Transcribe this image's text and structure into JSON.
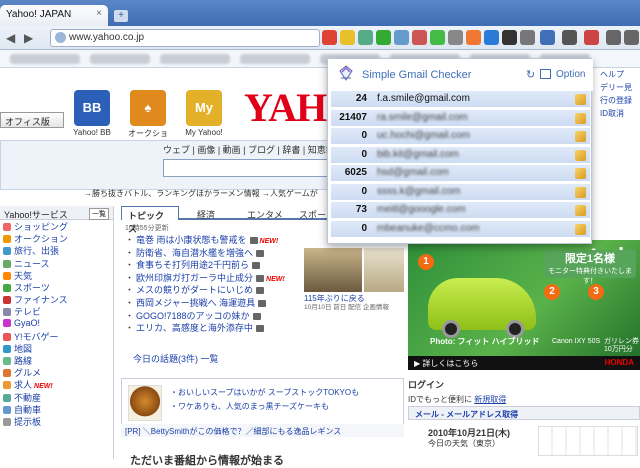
{
  "browser": {
    "tab_title": "Yahoo! JAPAN",
    "tab_close": "×",
    "new_tab": "+",
    "address": "www.yahoo.co.jp",
    "nav_back": "◀",
    "nav_forward": "▶"
  },
  "page": {
    "logo_text": "YAHO",
    "office_button": "オフィス版",
    "services": [
      {
        "label": "Yahoo! BB",
        "glyph": "BB",
        "color": "#2b5fb8"
      },
      {
        "label": "オークション",
        "glyph": "♠",
        "color": "#e08a1e"
      },
      {
        "label": "My Yahoo!",
        "glyph": "My",
        "color": "#e3b02a"
      }
    ],
    "search_tabs": "ウェブ | 画像 | 動画 | ブログ | 辞書 | 知恵袋",
    "promo_left": "→勝ち抜きバトル、ランキングほかラーメン情報",
    "promo_right": "→人気ゲームが",
    "sidebar": {
      "header": "Yahoo!サービス",
      "header_tag": "一覧",
      "items": [
        {
          "label": "ショッピング",
          "color": "#e66"
        },
        {
          "label": "オークション",
          "color": "#e90"
        },
        {
          "label": "旅行、出張",
          "color": "#49c"
        },
        {
          "label": "ニュース",
          "color": "#6a6"
        },
        {
          "label": "天気",
          "color": "#f80"
        },
        {
          "label": "スポーツ",
          "color": "#4a4"
        },
        {
          "label": "ファイナンス",
          "color": "#c33"
        },
        {
          "label": "テレビ",
          "color": "#88a"
        },
        {
          "label": "GyaO!",
          "color": "#c3c"
        },
        {
          "label": "Y!モバゲー",
          "color": "#e55"
        },
        {
          "label": "地図",
          "color": "#39c"
        },
        {
          "label": "路線",
          "color": "#6b8"
        },
        {
          "label": "グルメ",
          "color": "#d73"
        },
        {
          "label": "求人",
          "color": "#e93",
          "new": "NEW!"
        },
        {
          "label": "不動産",
          "color": "#5a9"
        },
        {
          "label": "自動車",
          "color": "#69c"
        },
        {
          "label": "提示板",
          "color": "#999"
        }
      ]
    },
    "topics": {
      "tabs": [
        "トピックス",
        "経済",
        "エンタメ",
        "スポー"
      ],
      "time": "10時55分更新",
      "items": [
        {
          "text": "竜巻 雨は小康状態も警戒を",
          "new": "NEW!"
        },
        {
          "text": "防衛省、海自潜水艦を増強へ",
          "new": ""
        },
        {
          "text": "食事ちそ打列用途2千円前ら",
          "new": ""
        },
        {
          "text": "欧州印旗ガ打ガーラ中止成分",
          "new": "NEW!"
        },
        {
          "text": "メスの競りがダートにいじめ",
          "new": ""
        },
        {
          "text": "西岡メジャー挑戦へ 海運遊具",
          "new": ""
        },
        {
          "text": "GOGO!7188のアッコの妹か",
          "new": ""
        },
        {
          "text": "エリカ、高感度と海外添存中",
          "new": ""
        }
      ],
      "photo_caption": "115年ぶりに戻る",
      "photo_sub": "10月10日 前日 配信 企画情報",
      "footer": "今日の話題(3件)  一覧"
    },
    "soup": {
      "line1": "・おいしいスープはいかが スープストックTOKYOも",
      "line2": "・ワケありも、人気のまっ黒チーズケーキも"
    },
    "pr": "[PR] ＼BettySmithがこの価格で？／細部にもる逸品レギンス",
    "bottom_heading": "ただいま番組から情報が始まる",
    "ad": {
      "top_text": "ント",
      "limited_big": "限定1名様",
      "limited_small": "モニター特典付きいたします！",
      "num1": "1",
      "num2": "2",
      "num3": "3",
      "car_caption": "Photo: フィット ハイブリッド",
      "cam_label": "Canon IXY 50S",
      "gps_label": "ガリレン券 10万円分",
      "bottom": "▶ 詳しくはこちら",
      "brand": "HONDA"
    },
    "login": {
      "title": "ログイン",
      "line": "IDでもっと便利に",
      "link": "新規取得",
      "mail_bar": "メール - メールアドレス取得",
      "date": "2010年10月21日(木)",
      "weather": "今日の天気（東京）"
    },
    "right_links": [
      "ヘルプ",
      "デリー見",
      "行の登録",
      "ID取消"
    ]
  },
  "gmail_checker": {
    "title": "Simple Gmail Checker",
    "refresh_icon": "↻",
    "option_label": "Option",
    "accounts": [
      {
        "count": "24",
        "email": "f.a.smile@gmail.com",
        "blurred": false
      },
      {
        "count": "21407",
        "email": "ra.smile@gmail.com",
        "blurred": true
      },
      {
        "count": "0",
        "email": "uc.hochi@gmail.com",
        "blurred": true
      },
      {
        "count": "0",
        "email": "bib.kit@gmail.com",
        "blurred": true
      },
      {
        "count": "6025",
        "email": "hsd@gmail.com",
        "blurred": true
      },
      {
        "count": "0",
        "email": "ssss.k@gmail.com",
        "blurred": true
      },
      {
        "count": "73",
        "email": "meitl@gooogle.com",
        "blurred": true
      },
      {
        "count": "0",
        "email": "mbeanuke@ccmo.com",
        "blurred": true
      }
    ]
  },
  "colors": {
    "accent": "#3e6fb7",
    "row_fill": "#d6e3f6",
    "yahoo_red": "#e1001a"
  }
}
